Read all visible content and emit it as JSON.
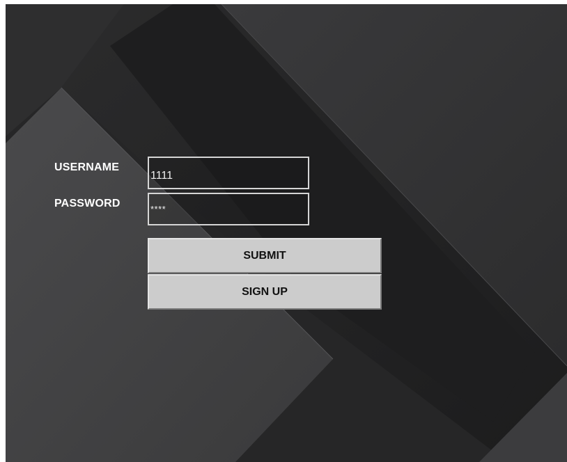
{
  "form": {
    "username_label": "USERNAME",
    "password_label": "PASSWORD",
    "username_value": "1111",
    "password_value": "****",
    "submit_label": "SUBMIT",
    "signup_label": "SIGN UP"
  },
  "colors": {
    "background": "#2a2a2a",
    "label_text": "#ffffff",
    "field_border": "#d6d6d6",
    "button_face": "#cccccc",
    "button_text": "#111111"
  }
}
